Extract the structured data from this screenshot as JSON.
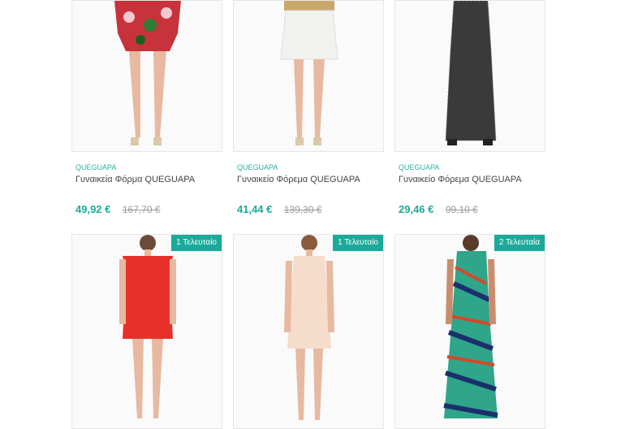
{
  "products": [
    {
      "brand": "QUEGUAPA",
      "title": "Γυναικεία Φόρμα QUEGUAPA",
      "price": "49,92 €",
      "old_price": "167,70 €",
      "badge": ""
    },
    {
      "brand": "QUEGUAPA",
      "title": "Γυναικείο Φόρεμα QUEGUAPA",
      "price": "41,44 €",
      "old_price": "139,30 €",
      "badge": ""
    },
    {
      "brand": "QUEGUAPA",
      "title": "Γυναικείο Φόρεμα QUEGUAPA",
      "price": "29,46 €",
      "old_price": "99,10 €",
      "badge": ""
    },
    {
      "brand": "",
      "title": "",
      "price": "",
      "old_price": "",
      "badge": "1 Τελευταίο"
    },
    {
      "brand": "",
      "title": "",
      "price": "",
      "old_price": "",
      "badge": "1 Τελευταίο"
    },
    {
      "brand": "",
      "title": "",
      "price": "",
      "old_price": "",
      "badge": "2 Τελευταία"
    }
  ],
  "colors": {
    "accent": "#1aaa9b"
  }
}
